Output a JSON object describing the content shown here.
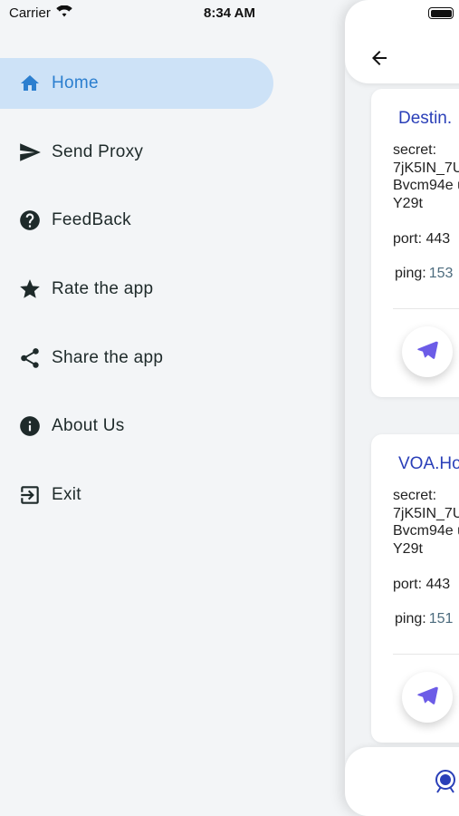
{
  "status_bar": {
    "carrier": "Carrier",
    "time": "8:34 AM"
  },
  "drawer": {
    "items": [
      {
        "label": "Home",
        "icon": "home-icon",
        "active": true
      },
      {
        "label": "Send Proxy",
        "icon": "send-icon",
        "active": false
      },
      {
        "label": "FeedBack",
        "icon": "help-icon",
        "active": false
      },
      {
        "label": "Rate the app",
        "icon": "star-icon",
        "active": false
      },
      {
        "label": "Share the app",
        "icon": "share-icon",
        "active": false
      },
      {
        "label": "About Us",
        "icon": "info-icon",
        "active": false
      },
      {
        "label": "Exit",
        "icon": "exit-icon",
        "active": false
      }
    ]
  },
  "proxies": [
    {
      "title": "Destin.",
      "secret_label": "secret:",
      "secret_value": "7jK5IN_7U Bvcm94e uY29t",
      "port_label": "port:",
      "port_value": "443",
      "ping_label": "ping:",
      "ping_value": "153"
    },
    {
      "title": "VOA.Ho",
      "secret_label": "secret:",
      "secret_value": "7jK5IN_7U Bvcm94e uY29t",
      "port_label": "port:",
      "port_value": "443",
      "ping_label": "ping:",
      "ping_value": "151"
    }
  ],
  "colors": {
    "accent": "#2c7fcf",
    "active_bg": "#cde2f7",
    "title_blue": "#2a3fb8",
    "send_purple": "#6c5ce7"
  }
}
